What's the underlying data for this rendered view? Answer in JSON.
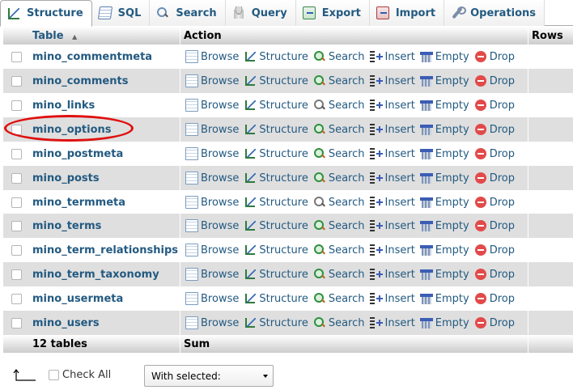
{
  "tabs": [
    {
      "label": "Structure",
      "icon": "structure-icon",
      "active": true
    },
    {
      "label": "SQL",
      "icon": "sql-icon"
    },
    {
      "label": "Search",
      "icon": "search-icon"
    },
    {
      "label": "Query",
      "icon": "query-icon"
    },
    {
      "label": "Export",
      "icon": "export-icon"
    },
    {
      "label": "Import",
      "icon": "import-icon"
    },
    {
      "label": "Operations",
      "icon": "operations-icon"
    }
  ],
  "table": {
    "headers": {
      "table": "Table",
      "sort_indicator": "▲",
      "action": "Action",
      "rows": "Rows"
    },
    "actions": {
      "browse": "Browse",
      "structure": "Structure",
      "search": "Search",
      "insert": "Insert",
      "empty": "Empty",
      "drop": "Drop"
    },
    "rows": [
      "mino_commentmeta",
      "mino_comments",
      "mino_links",
      "mino_options",
      "mino_postmeta",
      "mino_posts",
      "mino_termmeta",
      "mino_terms",
      "mino_term_relationships",
      "mino_term_taxonomy",
      "mino_usermeta",
      "mino_users"
    ],
    "footer": {
      "count": "12 tables",
      "sum": "Sum"
    }
  },
  "bottom": {
    "check_all": "Check All",
    "with_selected": "With selected:"
  },
  "highlight": {
    "row": "mino_options",
    "color": "#e01010"
  }
}
